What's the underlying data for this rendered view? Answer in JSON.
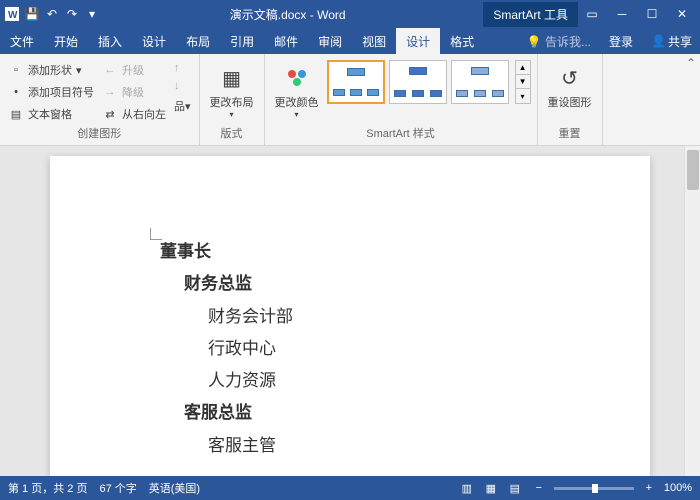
{
  "titlebar": {
    "doc_title": "演示文稿.docx - Word",
    "tool_tab": "SmartArt 工具"
  },
  "menu": {
    "file": "文件",
    "home": "开始",
    "insert": "插入",
    "design": "设计",
    "layout": "布局",
    "references": "引用",
    "mailings": "邮件",
    "review": "审阅",
    "view": "视图",
    "sa_design": "设计",
    "sa_format": "格式",
    "tell_me": "告诉我...",
    "login": "登录",
    "share": "共享"
  },
  "ribbon": {
    "create": {
      "add_shape": "添加形状",
      "add_bullet": "添加项目符号",
      "text_pane": "文本窗格",
      "promote": "升级",
      "demote": "降级",
      "rtl": "从右向左",
      "label": "创建图形"
    },
    "layouts": {
      "change_layout": "更改布局",
      "label": "版式"
    },
    "colors": {
      "change_colors": "更改颜色"
    },
    "styles": {
      "label": "SmartArt 样式"
    },
    "reset": {
      "reset_graphic": "重设图形",
      "label": "重置"
    }
  },
  "document": {
    "items": [
      {
        "level": 1,
        "text": "董事长"
      },
      {
        "level": 2,
        "text": "财务总监"
      },
      {
        "level": 3,
        "text": "财务会计部"
      },
      {
        "level": 3,
        "text": "行政中心"
      },
      {
        "level": 3,
        "text": "人力资源"
      },
      {
        "level": 2,
        "text": "客服总监"
      },
      {
        "level": 3,
        "text": "客服主管"
      }
    ]
  },
  "statusbar": {
    "page": "第 1 页，共 2 页",
    "words": "67 个字",
    "lang": "英语(美国)",
    "zoom": "100%"
  }
}
